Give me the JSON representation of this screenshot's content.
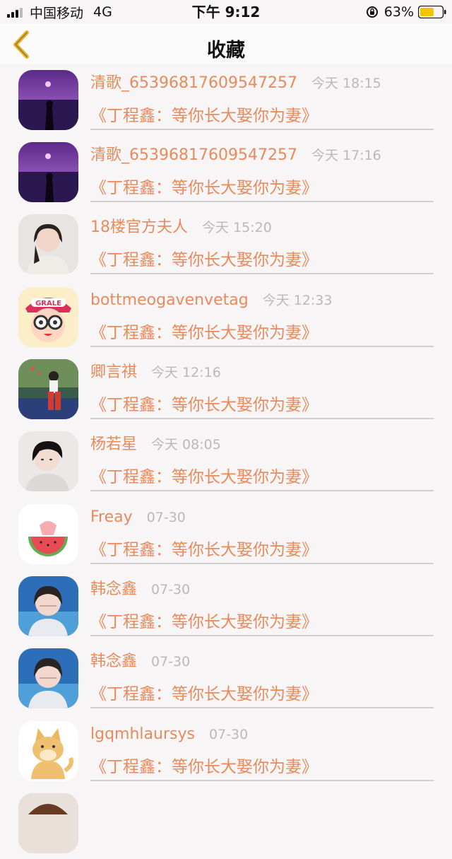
{
  "status_bar": {
    "carrier": "中国移动",
    "network": "4G",
    "time": "下午 9:12",
    "battery": "63%",
    "battery_level": 0.63
  },
  "nav": {
    "title": "收藏",
    "back_icon": "chevron-left-icon"
  },
  "colors": {
    "accent": "#e98a5c",
    "time_gray": "#b9b9b9",
    "battery_fill": "#f5c400"
  },
  "items": [
    {
      "name": "清歌_65396817609547257",
      "time": "今天 18:15",
      "work": "《丁程鑫：等你长大娶你为妻》"
    },
    {
      "name": "清歌_65396817609547257",
      "time": "今天 17:16",
      "work": "《丁程鑫：等你长大娶你为妻》"
    },
    {
      "name": "18楼官方夫人",
      "time": "今天 15:20",
      "work": "《丁程鑫：等你长大娶你为妻》"
    },
    {
      "name": "bottmeogavenvetag",
      "time": "今天 12:33",
      "work": "《丁程鑫：等你长大娶你为妻》"
    },
    {
      "name": "卿言祺",
      "time": "今天 12:16",
      "work": "《丁程鑫：等你长大娶你为妻》"
    },
    {
      "name": "杨若星",
      "time": "今天 08:05",
      "work": "《丁程鑫：等你长大娶你为妻》"
    },
    {
      "name": "Freay",
      "time": "07-30",
      "work": "《丁程鑫：等你长大娶你为妻》"
    },
    {
      "name": "韩念鑫",
      "time": "07-30",
      "work": "《丁程鑫：等你长大娶你为妻》"
    },
    {
      "name": "韩念鑫",
      "time": "07-30",
      "work": "《丁程鑫：等你长大娶你为妻》"
    },
    {
      "name": "lgqmhlaursys",
      "time": "07-30",
      "work": "《丁程鑫：等你长大娶你为妻》"
    }
  ]
}
